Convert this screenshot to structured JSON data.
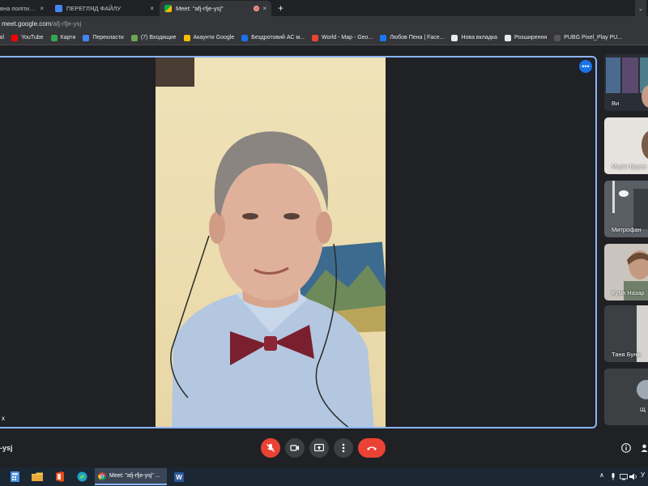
{
  "browser": {
    "tabs": [
      {
        "label": "вна політика (",
        "active": false
      },
      {
        "label": "ПЕРЕГЛЯД ФАЙЛУ",
        "active": false
      },
      {
        "label": "Meet: \"afj-rfje-ysj\"",
        "active": true
      }
    ],
    "close_glyph": "×",
    "new_tab_glyph": "+",
    "tab_list_glyph": "⌄",
    "address": {
      "host": "meet.google.com",
      "path": "/afj-rfje-ysj"
    },
    "bookmarks": [
      {
        "label": "ail",
        "icon": "gmail-icon",
        "color": "#d93025"
      },
      {
        "label": "YouTube",
        "icon": "youtube-icon",
        "color": "#ff0000"
      },
      {
        "label": "Карти",
        "icon": "maps-icon",
        "color": "#34a853"
      },
      {
        "label": "Перекласти",
        "icon": "translate-icon",
        "color": "#4285f4"
      },
      {
        "label": "(7) Входящие",
        "icon": "mail-icon",
        "color": "#6aa84f"
      },
      {
        "label": "Акаунти Google",
        "icon": "google-accounts-icon",
        "color": "#fbbc04"
      },
      {
        "label": "Бездротовий АС м...",
        "icon": "bookmark-site-icon",
        "color": "#1a73e8"
      },
      {
        "label": "World - Map - Geo...",
        "icon": "location-pin-icon",
        "color": "#ea4335"
      },
      {
        "label": "Любов Пена | Face...",
        "icon": "facebook-icon",
        "color": "#1877f2"
      },
      {
        "label": "Нова вкладка",
        "icon": "globe-icon",
        "color": "#e8eaed"
      },
      {
        "label": "Розширення",
        "icon": "puzzle-icon",
        "color": "#e8eaed"
      },
      {
        "label": "PUBG Pixel_Play PU...",
        "icon": "pubg-icon",
        "color": "#555"
      }
    ]
  },
  "meet": {
    "main_participant_name": "х",
    "more_options_glyph": "•••",
    "meeting_code": "-ysj",
    "participants": [
      {
        "name": "Ви"
      },
      {
        "name": "Марія Бруєв"
      },
      {
        "name": "Митрофан"
      },
      {
        "name": "Кузів Назар"
      },
      {
        "name": "Таня Бунік"
      },
      {
        "name": "Щ"
      }
    ],
    "controls": [
      {
        "icon": "mic-off-icon",
        "state": "muted"
      },
      {
        "icon": "camera-icon",
        "state": "on"
      },
      {
        "icon": "present-screen-icon"
      },
      {
        "icon": "more-vert-icon"
      },
      {
        "icon": "leave-call-icon"
      }
    ]
  },
  "taskbar": {
    "active_window": "Meet: \"afj-rfje-ysj\" ...",
    "tray_text": "У",
    "tray_glyph": "∧"
  },
  "colors": {
    "accent": "#8ab4f8",
    "danger": "#ea4335",
    "meet_blue": "#1a73e8",
    "background": "#202124"
  }
}
